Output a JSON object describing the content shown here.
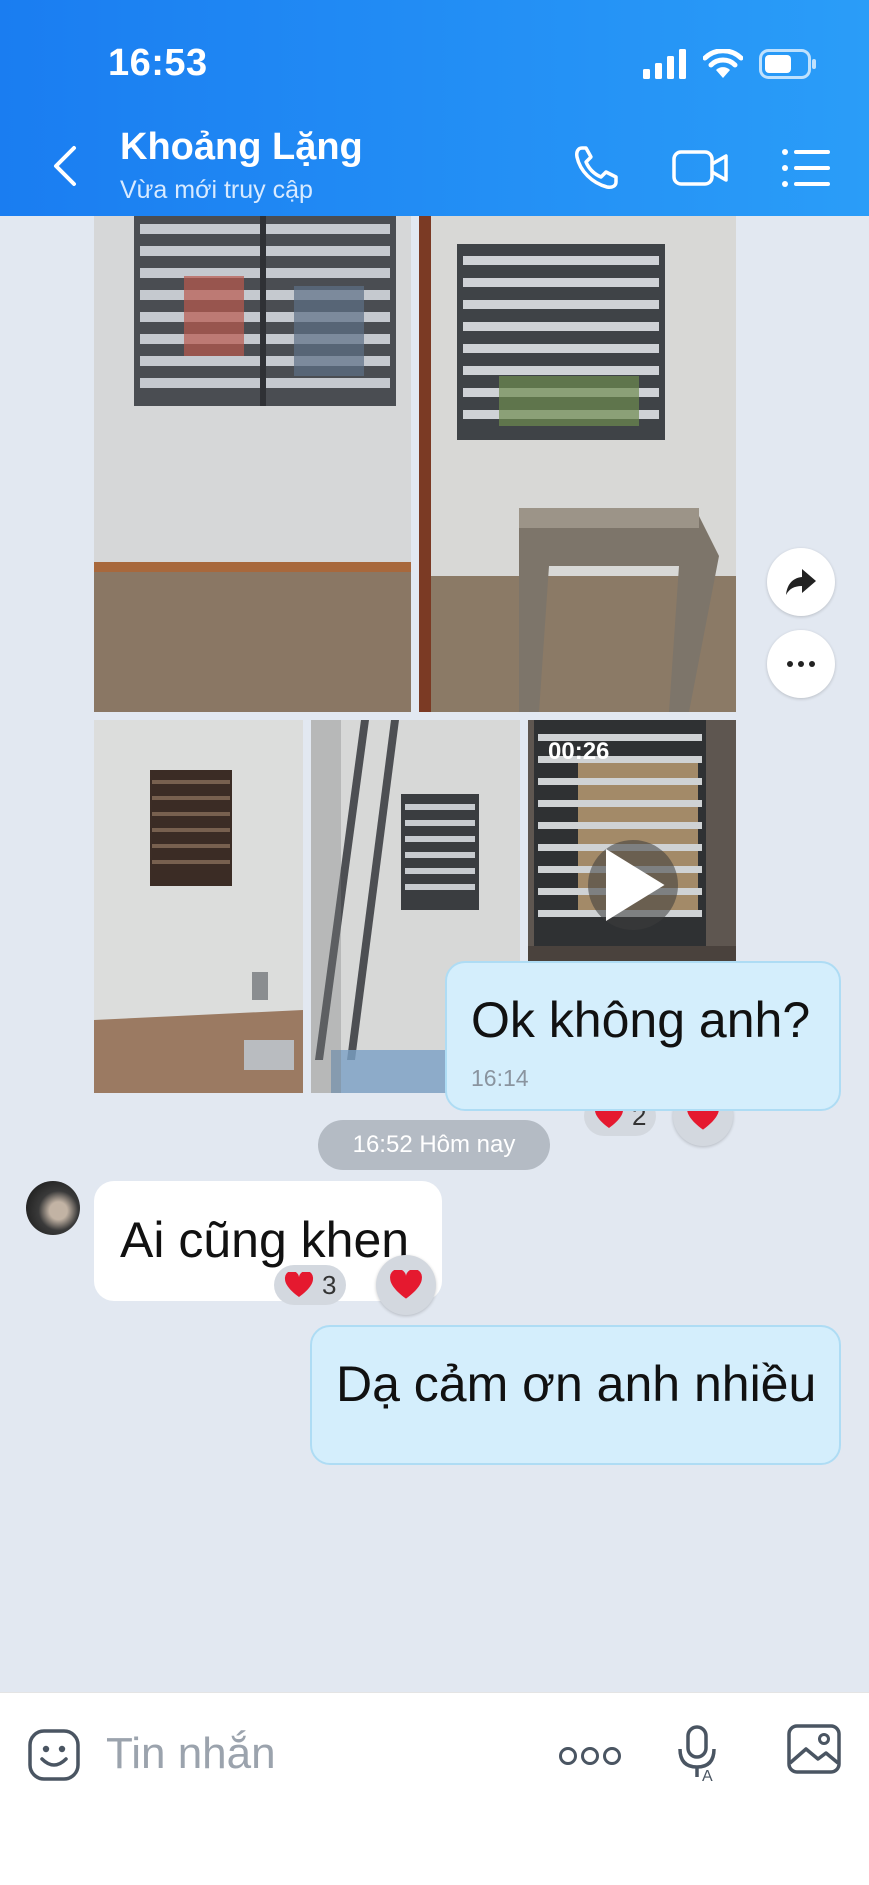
{
  "status_bar": {
    "time": "16:53"
  },
  "header": {
    "title": "Khoảng Lặng",
    "subtitle": "Vừa mới truy cập",
    "icons": [
      "back-icon",
      "phone-icon",
      "video-call-icon",
      "list-menu-icon"
    ]
  },
  "album": {
    "video_duration": "00:26",
    "reaction_count": "2",
    "colors": {
      "reaction": "#e5192f"
    }
  },
  "messages": {
    "m1": {
      "text": "Ok không anh?",
      "time": "16:14"
    },
    "date_separator": "16:52 Hôm nay",
    "m2": {
      "text": "Ai cũng khen",
      "reaction_count": "3"
    },
    "m3": {
      "text": "Dạ cảm ơn anh nhiều"
    }
  },
  "composer": {
    "placeholder": "Tin nhắn",
    "icons": [
      "emoji-icon",
      "more-dots-icon",
      "voice-text-icon",
      "image-icon"
    ]
  },
  "colors": {
    "header": "#1a7df1",
    "bubble_out": "#d4eefc",
    "background": "#e2e8f1"
  }
}
